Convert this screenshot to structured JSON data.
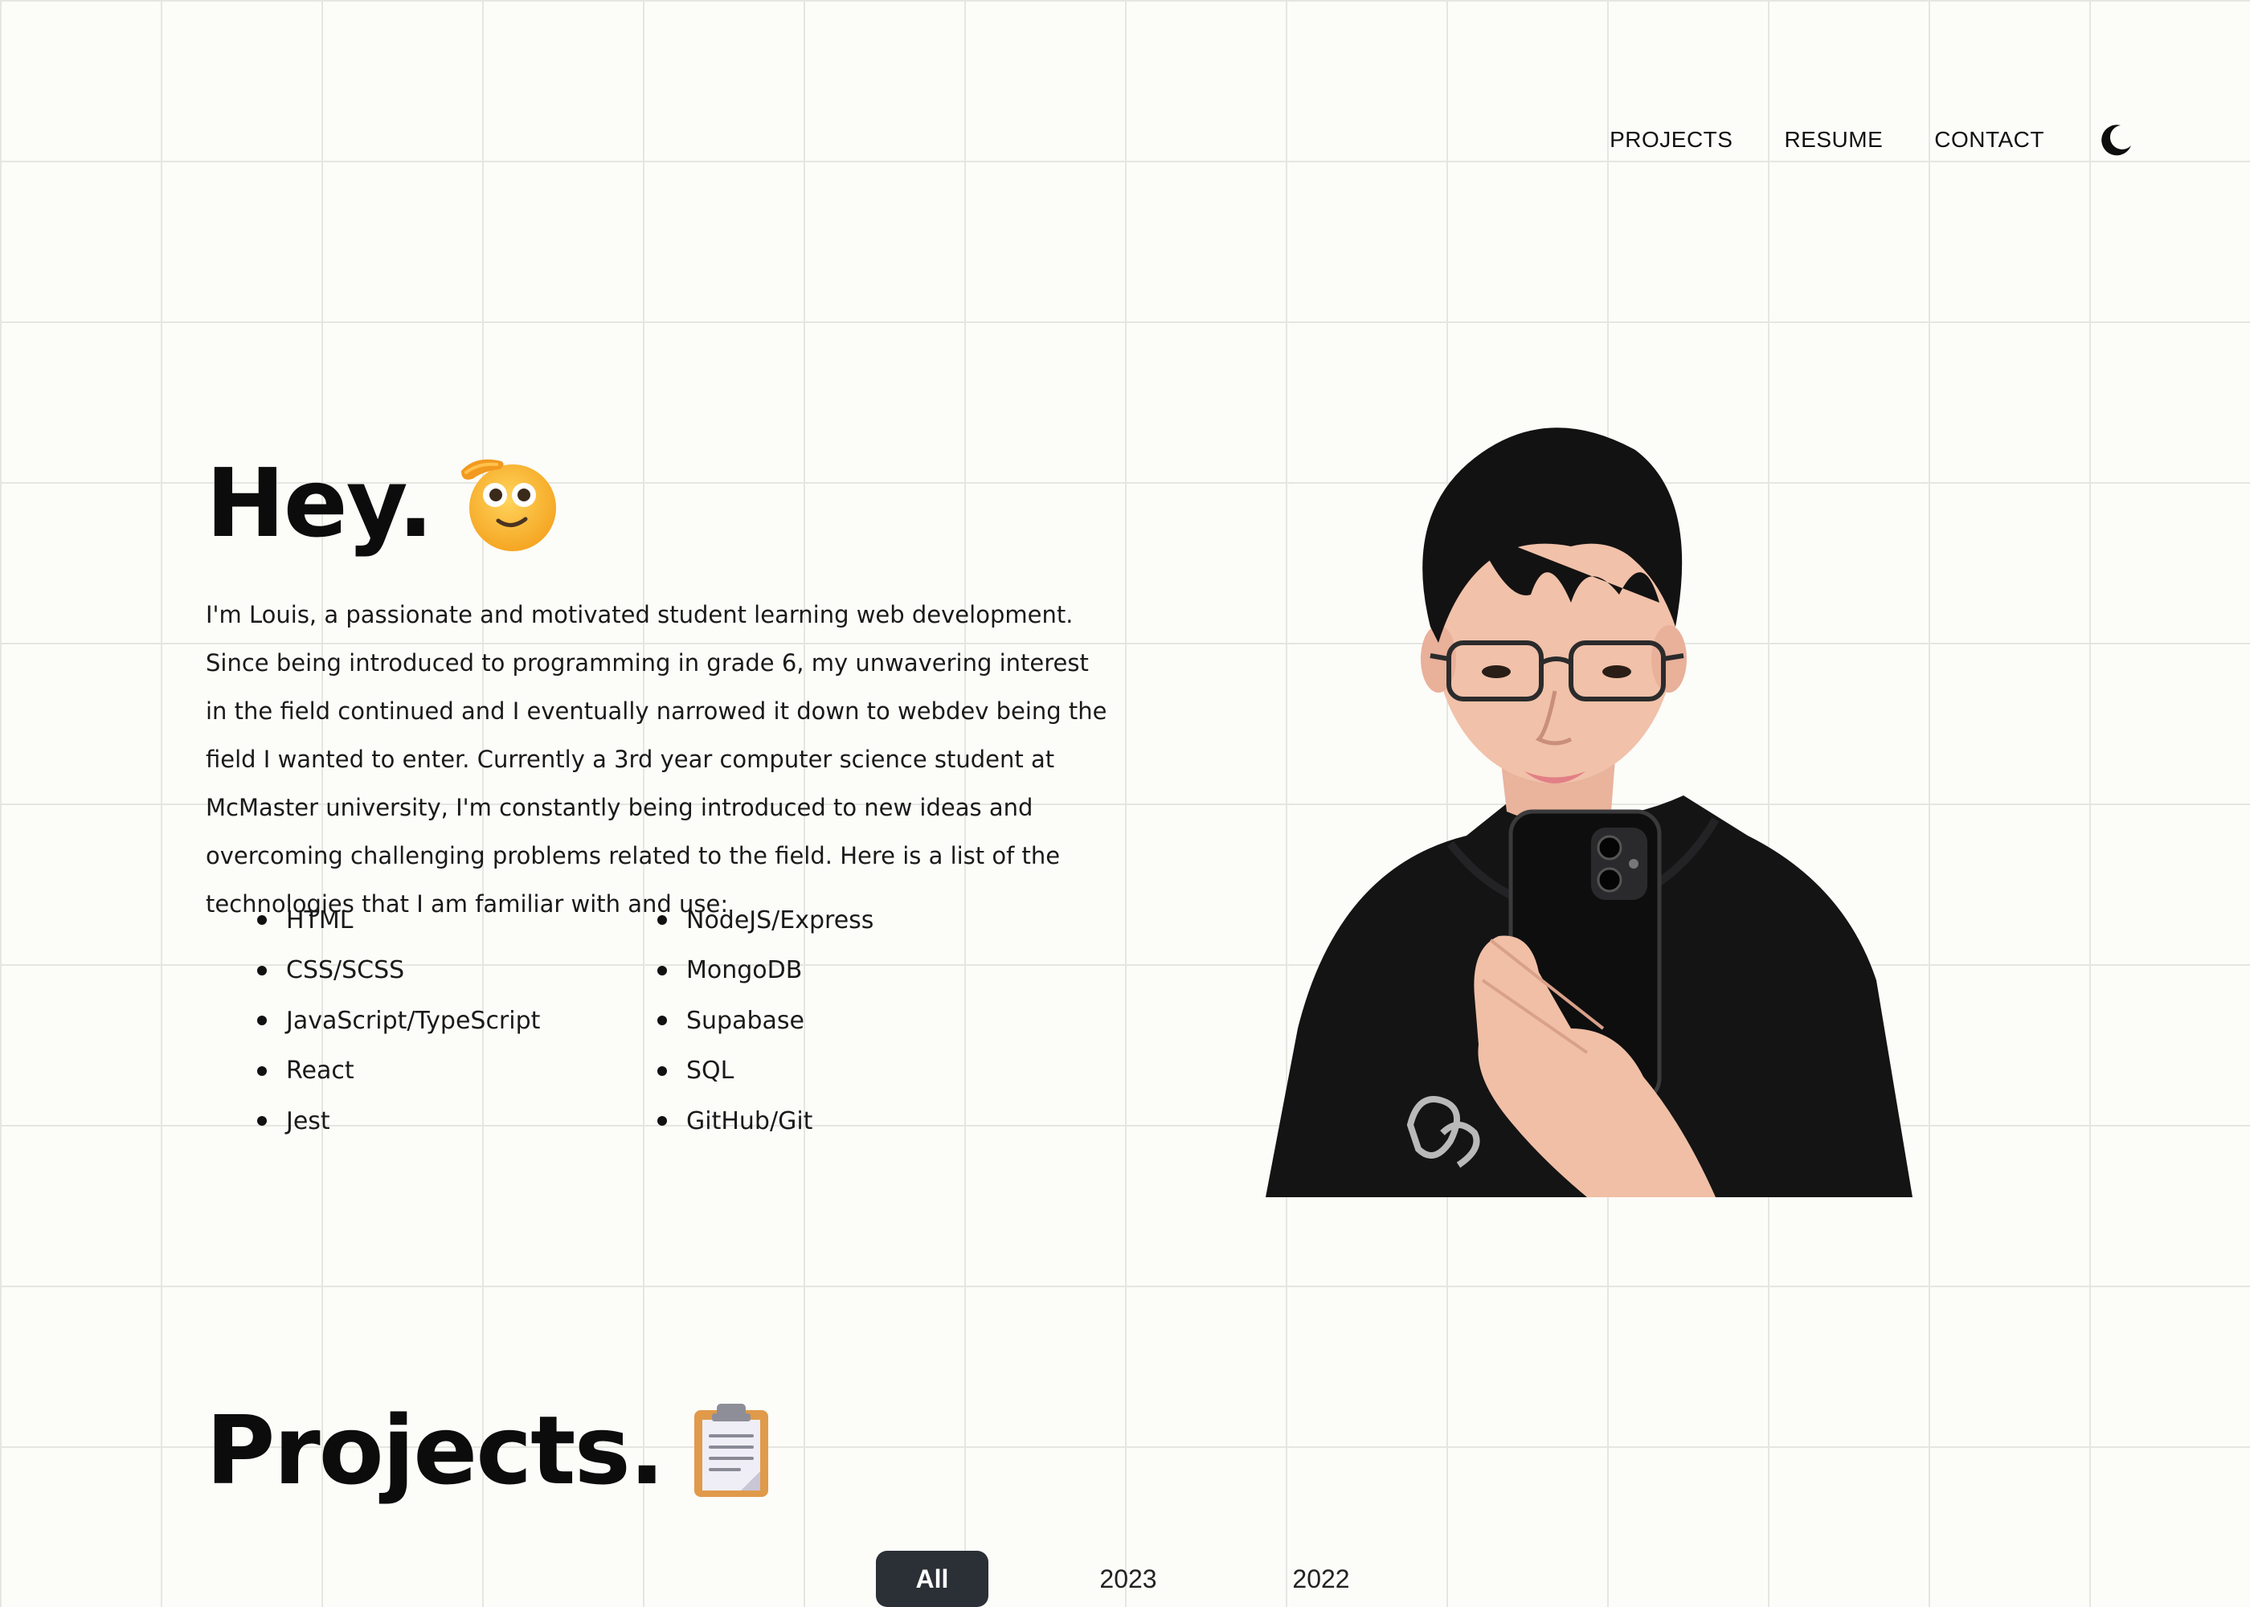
{
  "nav": {
    "links": [
      "PROJECTS",
      "RESUME",
      "CONTACT"
    ],
    "theme_icon": "moon-icon"
  },
  "hero": {
    "title": "Hey.",
    "emoji": "saluting-face-emoji",
    "intro": "I'm Louis, a passionate and motivated student learning web development. Since being introduced to programming in grade 6, my unwavering interest in the field continued and I eventually narrowed it down to webdev being the field I wanted to enter. Currently a 3rd year computer science student at McMaster university, I'm constantly being introduced to new ideas and overcoming challenging problems related to the field. Here is a list of the technologies that I am familiar with and use:",
    "technologies": [
      "HTML",
      "NodeJS/Express",
      "CSS/SCSS",
      "MongoDB",
      "JavaScript/TypeScript",
      "Supabase",
      "React",
      "SQL",
      "Jest",
      "GitHub/Git"
    ]
  },
  "projects": {
    "title": "Projects.",
    "emoji": "clipboard-emoji",
    "filters": [
      "All",
      "2023",
      "2022"
    ],
    "active_filter": "All"
  },
  "colors": {
    "background": "#fcfcf9",
    "grid_line": "#e6e6e1",
    "text": "#111111",
    "active_filter_bg": "#2b2f36",
    "emoji_yellow": "#f8b52e",
    "clipboard_orange": "#e09a4a"
  }
}
